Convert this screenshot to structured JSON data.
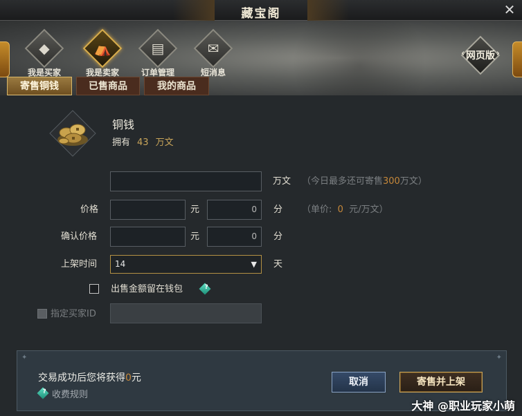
{
  "window": {
    "title": "藏宝阁",
    "close_glyph": "✕"
  },
  "nav": [
    {
      "label": "我是买家",
      "icon": "buyer-icon",
      "glyph": "◆"
    },
    {
      "label": "我是卖家",
      "icon": "seller-stall-icon",
      "glyph": "⛺"
    },
    {
      "label": "订单管理",
      "icon": "book-icon",
      "glyph": "▤"
    },
    {
      "label": "短消息",
      "icon": "mail-icon",
      "glyph": "✉"
    }
  ],
  "web_version": {
    "label": "网页版",
    "left_arrow": "‹",
    "right_arrow": "›"
  },
  "tabs": [
    "寄售铜钱",
    "已售商品",
    "我的商品"
  ],
  "item": {
    "name": "铜钱",
    "own_label": "拥有",
    "own_amount": "43",
    "own_unit": "万文",
    "icon": "copper-coins-icon"
  },
  "form": {
    "amount_unit": "万文",
    "amount_hint_pre": "（今日最多还可寄售",
    "amount_hint_value": "300",
    "amount_hint_post": "万文）",
    "price_label": "价格",
    "yuan_label": "元",
    "fen_label": "分",
    "price_fen_value": "0",
    "unit_price_hint_pre": "（单价:",
    "unit_price_value": "0",
    "unit_price_hint_post": "元/万文）",
    "confirm_price_label": "确认价格",
    "confirm_fen_value": "0",
    "shelf_time_label": "上架时间",
    "shelf_time_value": "14",
    "day_label": "天",
    "keep_wallet_label": "出售金额留在钱包",
    "designated_buyer_label": "指定买家ID"
  },
  "footer": {
    "text_pre": "交易成功后您将获得",
    "amount": "0",
    "text_post": "元",
    "rules_label": "收费规则",
    "cancel_label": "取消",
    "confirm_label": "寄售并上架"
  },
  "watermark": "大神 @职业玩家小萌",
  "colors": {
    "accent_gold": "#c9a55a",
    "highlight_orange": "#c6883a",
    "cancel_blue": "#2f4560"
  }
}
